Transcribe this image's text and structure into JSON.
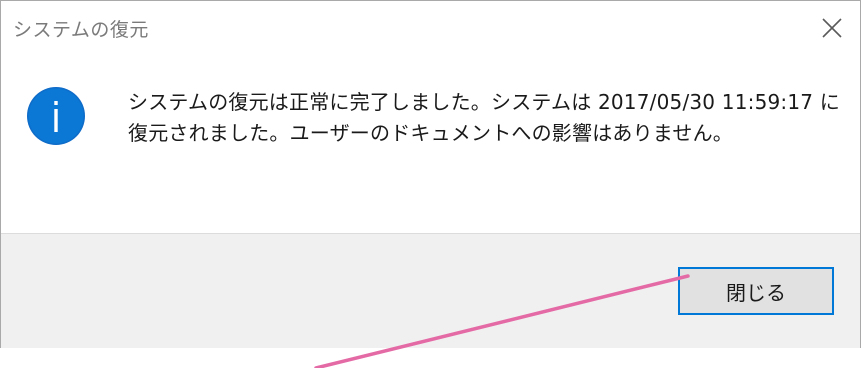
{
  "window": {
    "title": "システムの復元"
  },
  "message": {
    "line1": "システムの復元は正常に完了しました。システムは 2017/05/30 11:59:17 に",
    "line2": "復元されました。ユーザーのドキュメントへの影響はありません。"
  },
  "buttons": {
    "close_label": "閉じる"
  },
  "colors": {
    "accent": "#0078d7",
    "annotation_line": "#e46aa6"
  },
  "icons": {
    "window_close": "close-icon",
    "message": "info-icon"
  }
}
